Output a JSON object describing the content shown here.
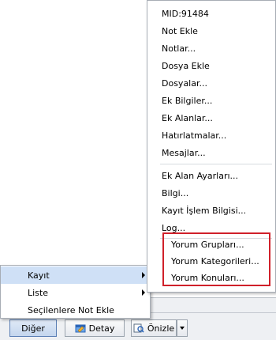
{
  "context_menu": {
    "items": [
      {
        "label": "MID:91484"
      },
      {
        "label": "Not Ekle"
      },
      {
        "label": "Notlar..."
      },
      {
        "label": "Dosya Ekle"
      },
      {
        "label": "Dosyalar..."
      },
      {
        "label": "Ek Bilgiler..."
      },
      {
        "label": "Ek Alanlar..."
      },
      {
        "label": "Hatırlatmalar..."
      },
      {
        "label": "Mesajlar..."
      },
      {
        "label": "Ek Alan Ayarları..."
      },
      {
        "label": "Bilgi..."
      },
      {
        "label": "Kayıt İşlem Bilgisi..."
      },
      {
        "label": "Log..."
      },
      {
        "label": "Yorum Grupları..."
      },
      {
        "label": "Yorum Kategorileri..."
      },
      {
        "label": "Yorum Konuları..."
      }
    ],
    "highlight_color": "#d0202a"
  },
  "parent_menu": {
    "items": [
      {
        "label": "Kayıt",
        "has_submenu": true,
        "selected": true
      },
      {
        "label": "Liste",
        "has_submenu": true
      },
      {
        "label": "Seçilenlere Not Ekle"
      }
    ],
    "selection_color": "#cfe0f6"
  },
  "toolbar": {
    "diger_label": "Diğer",
    "detay_label": "Detay",
    "onizle_label": "Önizle"
  }
}
